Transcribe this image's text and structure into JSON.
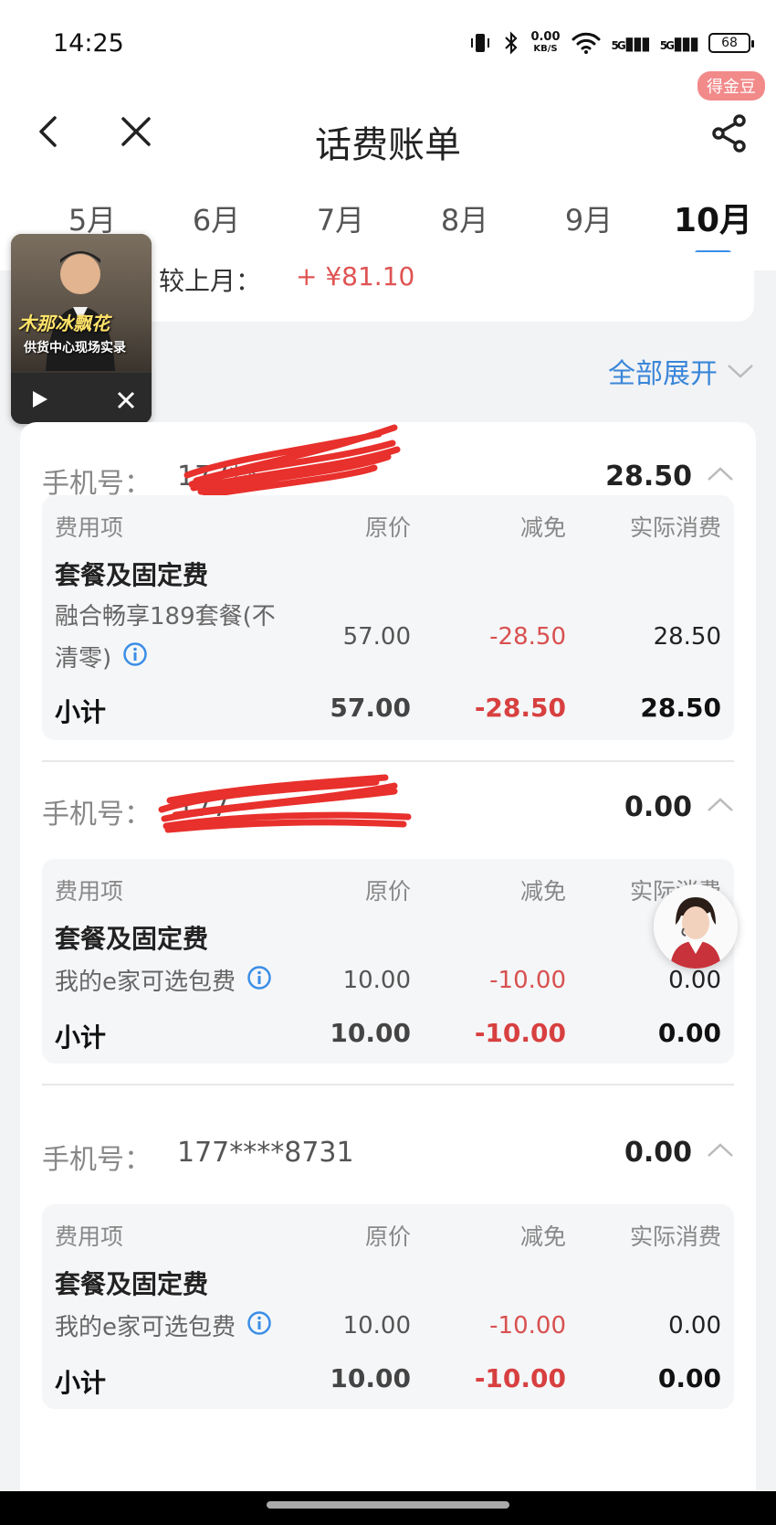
{
  "status_bar": {
    "time": "14:25",
    "net_speed_value": "0.00",
    "net_speed_unit": "KB/S",
    "signal_labels": [
      "5G",
      "5G"
    ],
    "battery": "68"
  },
  "header": {
    "title": "话费账单",
    "badge": "得金豆"
  },
  "tabs": [
    {
      "label": "5月"
    },
    {
      "label": "6月"
    },
    {
      "label": "7月"
    },
    {
      "label": "8月"
    },
    {
      "label": "9月"
    },
    {
      "label": "10月"
    }
  ],
  "summary": {
    "label": "较上月：",
    "value": "+ ¥81.10"
  },
  "video": {
    "caption_main": "木那冰飘花",
    "caption_sub": "供货中心现场实录"
  },
  "expand_all": "全部展开",
  "table_headers": {
    "col0": "费用项",
    "col1": "原价",
    "col2": "减免",
    "col3": "实际消费"
  },
  "phones": [
    {
      "label": "手机号：",
      "number": "177**",
      "total": "28.50",
      "section": "套餐及固定费",
      "item_line1": "融合畅享189套餐(不",
      "item_line2": "清零)",
      "orig": "57.00",
      "discount": "-28.50",
      "actual": "28.50",
      "subtotal_label": "小计",
      "sub_orig": "57.00",
      "sub_discount": "-28.50",
      "sub_actual": "28.50"
    },
    {
      "label": "手机号：",
      "number": "177",
      "total": "0.00",
      "section": "套餐及固定费",
      "item": "我的e家可选包费",
      "orig": "10.00",
      "discount": "-10.00",
      "actual": "0.00",
      "subtotal_label": "小计",
      "sub_orig": "10.00",
      "sub_discount": "-10.00",
      "sub_actual": "0.00"
    },
    {
      "label": "手机号：",
      "number": "177****8731",
      "total": "0.00",
      "section": "套餐及固定费",
      "item": "我的e家可选包费",
      "orig": "10.00",
      "discount": "-10.00",
      "actual": "0.00",
      "subtotal_label": "小计",
      "sub_orig": "10.00",
      "sub_discount": "-10.00",
      "sub_actual": "0.00"
    }
  ],
  "colors": {
    "accent": "#3a8ee6",
    "negative": "#d85050",
    "redaction": "#e8302c"
  }
}
